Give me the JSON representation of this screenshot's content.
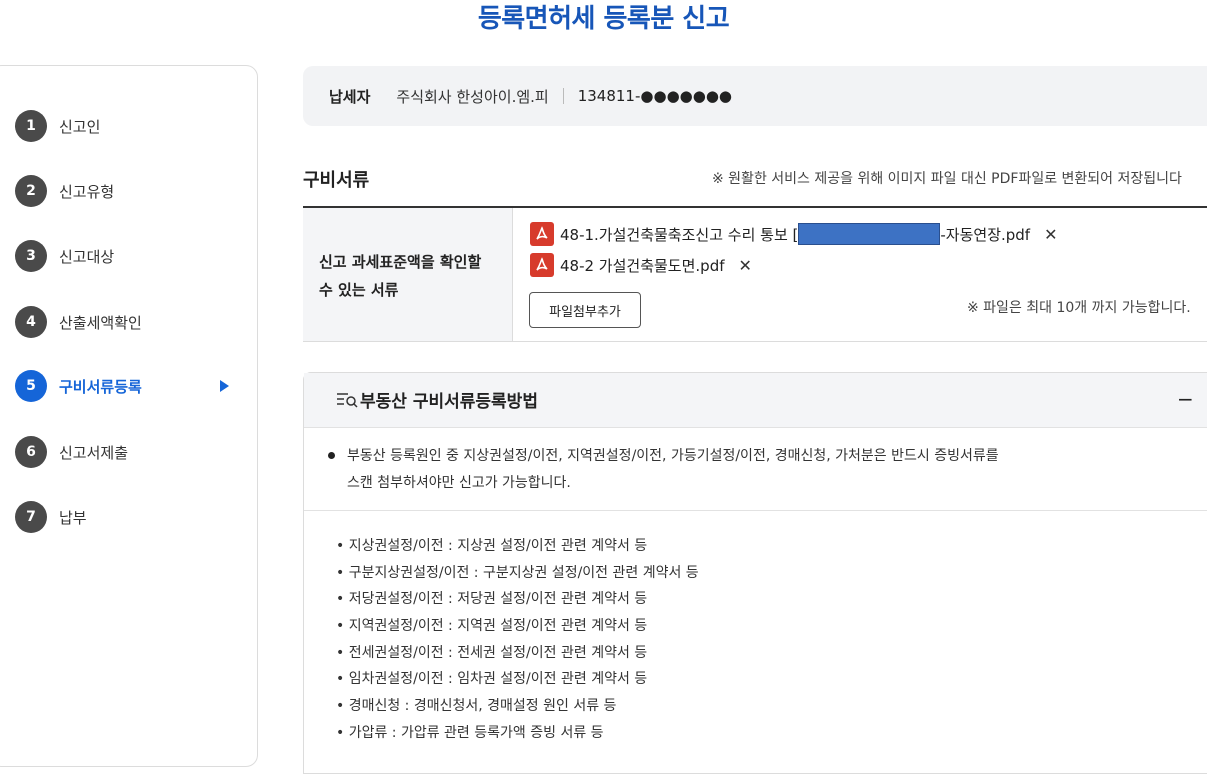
{
  "page": {
    "title": "등록면허세 등록분 신고"
  },
  "steps": [
    {
      "num": "1",
      "label": "신고인"
    },
    {
      "num": "2",
      "label": "신고유형"
    },
    {
      "num": "3",
      "label": "신고대상"
    },
    {
      "num": "4",
      "label": "산출세액확인"
    },
    {
      "num": "5",
      "label": "구비서류등록"
    },
    {
      "num": "6",
      "label": "신고서제출"
    },
    {
      "num": "7",
      "label": "납부"
    }
  ],
  "taxpayer": {
    "label": "납세자",
    "name": "주식회사 한성아이.엠.피",
    "reg_no": "134811-●●●●●●●"
  },
  "documents": {
    "title": "구비서류",
    "notice": "※ 원활한 서비스 제공을 위해 이미지 파일 대신 PDF파일로 변환되어 저장됩니다",
    "row_header": "신고 과세표준액을 확인할 수 있는 서류",
    "files": [
      {
        "prefix": "48-1.가설건축물축조신고 수리 통보 [",
        "suffix": "-자동연장.pdf",
        "redacted": true
      },
      {
        "prefix": "48-2 가설건축물도면.pdf",
        "suffix": "",
        "redacted": false
      }
    ],
    "remove_icon": "✕",
    "attach_button": "파일첨부추가",
    "attach_note": "※ 파일은 최대 10개 까지 가능합니다."
  },
  "guide": {
    "title": "부동산 구비서류등록방법",
    "collapse_icon": "−",
    "notice_line1": "부동산 등록원인 중 지상권설정/이전, 지역권설정/이전, 가등기설정/이전, 경매신청, 가처분은 반드시 증빙서류를",
    "notice_line2": "스캔 첨부하셔야만 신고가 가능합니다.",
    "items": [
      "• 지상권설정/이전 : 지상권 설정/이전 관련 계약서 등",
      "• 구분지상권설정/이전 : 구분지상권 설정/이전 관련 계약서 등",
      "• 저당권설정/이전 : 저당권 설정/이전 관련 계약서 등",
      "• 지역권설정/이전 : 지역권 설정/이전 관련 계약서 등",
      "• 전세권설정/이전 : 전세권 설정/이전 관련 계약서 등",
      "• 임차권설정/이전 : 임차권 설정/이전 관련 계약서 등",
      "• 경매신청 : 경매신청서, 경매설정 원인 서류 등",
      "• 가압류 : 가압류 관련 등록가액 증빙 서류 등"
    ]
  },
  "colors": {
    "accent": "#1565d8",
    "title": "#1756b8",
    "pdf": "#d73b2c"
  },
  "icons": {
    "pdf": "pdf-file-icon",
    "guide": "guide-list-icon",
    "active_step": "triangle-right-icon"
  }
}
